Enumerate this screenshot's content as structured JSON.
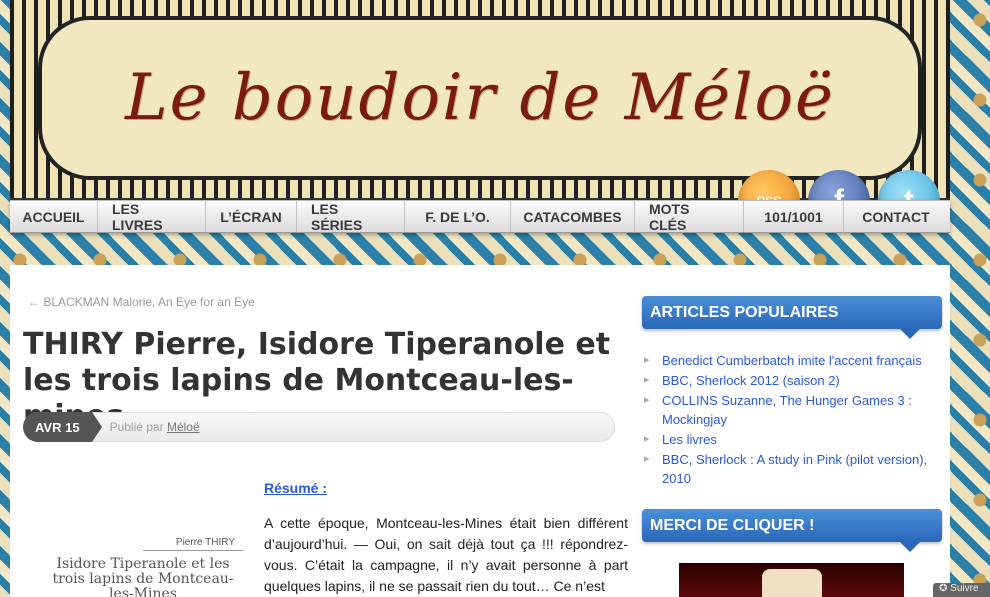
{
  "header": {
    "site_title": "Le boudoir de Méloë"
  },
  "social": {
    "rss_label": "RSS",
    "facebook_label": "f",
    "twitter_label": "t"
  },
  "nav": {
    "items": [
      {
        "label": "ACCUEIL"
      },
      {
        "label": "LES LIVRES"
      },
      {
        "label": "L’ÉCRAN"
      },
      {
        "label": "LES SÉRIES"
      },
      {
        "label": "F. DE L’O."
      },
      {
        "label": "CATACOMBES"
      },
      {
        "label": "MOTS CLÉS"
      },
      {
        "label": "101/1001"
      },
      {
        "label": "CONTACT"
      }
    ]
  },
  "post": {
    "prev_link": "← BLACKMAN Malorie, An Eye for an Eye",
    "title": "THIRY Pierre, Isidore Tiperanole et les trois lapins de Montceau-les-mines",
    "date": "AVR 15",
    "published_by": "Publié par",
    "author": "Méloë",
    "resume_label": "Résumé",
    "resume_colon": " :",
    "body": "A cette époque, Montceau-les-Mines était bien différent d’aujourd’hui. — Oui, on sait déjà tout ça !!! répondrez-vous. C’était la campagne, il n’y avait personne à part quelques lapins, il ne se passait rien du tout… Ce n’est"
  },
  "cover": {
    "author": "Pierre THIRY",
    "title": "Isidore Tiperanole et les trois lapins de Montceau-les-Mines"
  },
  "sidebar": {
    "popular_title": "ARTICLES POPULAIRES",
    "popular_items": [
      {
        "label": "Benedict Cumberbatch imite l'accent français"
      },
      {
        "label": "BBC, Sherlock 2012 (saison 2)"
      },
      {
        "label": "COLLINS Suzanne, The Hunger Games 3 : Mockingjay"
      },
      {
        "label": "Les livres"
      },
      {
        "label": "BBC, Sherlock : A study in Pink (pilot version), 2010"
      }
    ],
    "merci_title": "MERCI DE CLIQUER !"
  },
  "follow_label": "✪ Suivre",
  "colors": {
    "link": "#2a5bd7",
    "widget": "#2a67b8",
    "title_red": "#7a1a10"
  }
}
